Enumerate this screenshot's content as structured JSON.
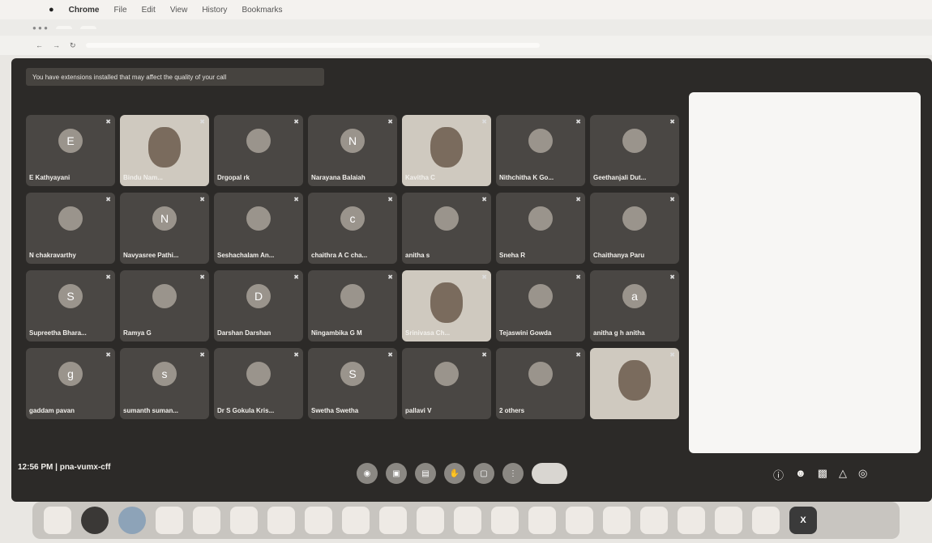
{
  "menubar": {
    "app": "Chrome",
    "items": [
      "File",
      "Edit",
      "View",
      "History",
      "Bookmarks"
    ]
  },
  "meet": {
    "banner": "You have extensions installed that may affect the quality of your call",
    "time_code": "12:56 PM  |  pna-vumx-cff",
    "participants": [
      {
        "name": "E Kathyayani",
        "initial": "E"
      },
      {
        "name": "Bindu Nam...",
        "initial": ""
      },
      {
        "name": "Drgopal rk",
        "initial": ""
      },
      {
        "name": "Narayana Balaiah",
        "initial": "N"
      },
      {
        "name": "Kavitha C",
        "initial": ""
      },
      {
        "name": "Nithchitha K Go...",
        "initial": ""
      },
      {
        "name": "Geethanjali Dut...",
        "initial": ""
      },
      {
        "name": "N chakravarthy",
        "initial": ""
      },
      {
        "name": "Navyasree Pathi...",
        "initial": "N"
      },
      {
        "name": "Seshachalam An...",
        "initial": ""
      },
      {
        "name": "chaithra A C cha...",
        "initial": "c"
      },
      {
        "name": "anitha s",
        "initial": ""
      },
      {
        "name": "Sneha R",
        "initial": ""
      },
      {
        "name": "Chaithanya Paru",
        "initial": ""
      },
      {
        "name": "Supreetha Bhara...",
        "initial": "S"
      },
      {
        "name": "Ramya G",
        "initial": ""
      },
      {
        "name": "Darshan Darshan",
        "initial": "D"
      },
      {
        "name": "Ningambika G M",
        "initial": ""
      },
      {
        "name": "Srinivasa Ch...",
        "initial": ""
      },
      {
        "name": "Tejaswini Gowda",
        "initial": ""
      },
      {
        "name": "anitha g h anitha",
        "initial": "a"
      },
      {
        "name": "gaddam pavan",
        "initial": "g"
      },
      {
        "name": "sumanth suman...",
        "initial": "s"
      },
      {
        "name": "Dr S Gokula Kris...",
        "initial": ""
      },
      {
        "name": "Swetha Swetha",
        "initial": "S"
      },
      {
        "name": "pallavi V",
        "initial": ""
      },
      {
        "name": "2 others",
        "initial": ""
      },
      {
        "name": "",
        "initial": ""
      }
    ]
  }
}
